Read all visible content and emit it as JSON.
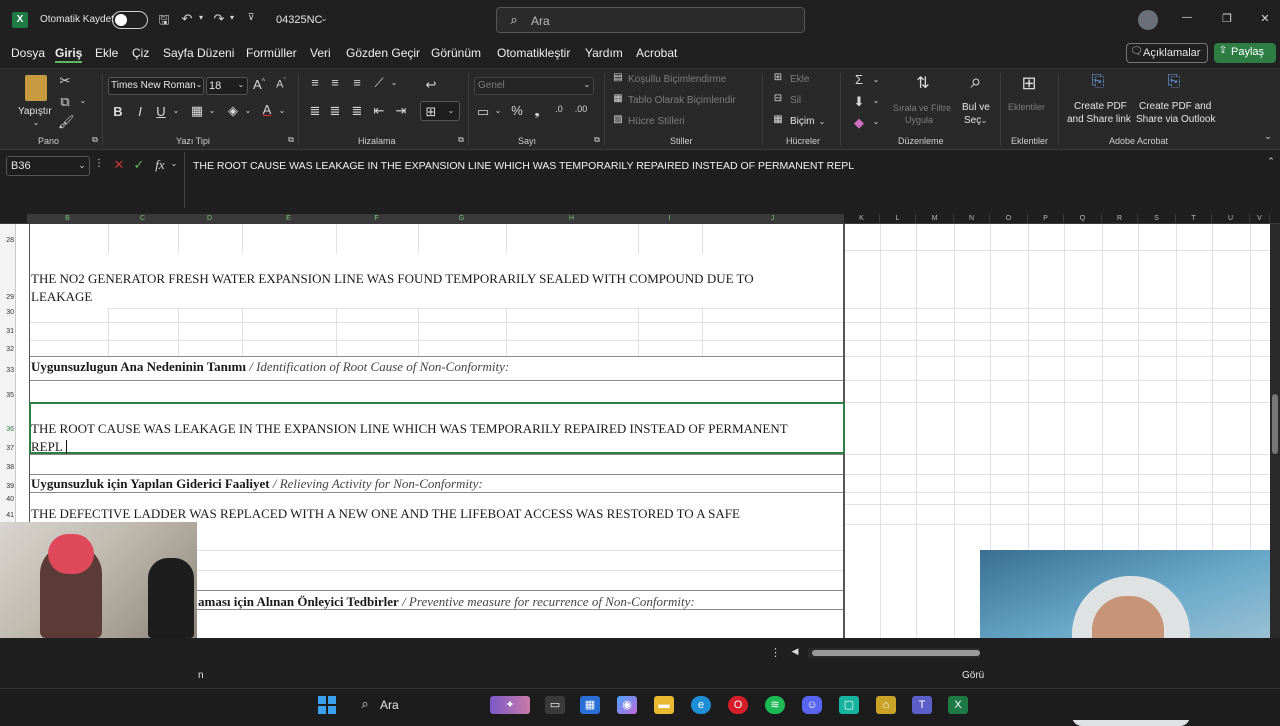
{
  "titlebar": {
    "autosave_label": "Otomatik Kaydet",
    "filename": "04325NC",
    "search_placeholder": "Ara",
    "minimize": "—",
    "maximize": "❐",
    "close": "✕"
  },
  "menu": {
    "items": [
      "Dosya",
      "Giriş",
      "Ekle",
      "Çiz",
      "Sayfa Düzeni",
      "Formüller",
      "Veri",
      "Gözden Geçir",
      "Görünüm",
      "Otomatikleştir",
      "Yardım",
      "Acrobat"
    ],
    "comments": "Açıklamalar",
    "share": "Paylaş"
  },
  "ribbon": {
    "paste": "Yapıştır",
    "clipboard_group": "Pano",
    "font_name": "Times New Roman",
    "font_size": "18",
    "font_group": "Yazı Tipi",
    "alignment_group": "Hizalama",
    "number_format": "Genel",
    "number_group": "Sayı",
    "conditional": "Koşullu Biçimlendirme",
    "format_table": "Tablo Olarak Biçimlendir",
    "cell_styles": "Hücre Stilleri",
    "styles_group": "Stiller",
    "insert": "Ekle",
    "delete": "Sil",
    "format": "Biçim",
    "cells_group": "Hücreler",
    "sort_filter_line1": "Sırala ve Filtre",
    "sort_filter_line2": "Uygula",
    "find_line1": "Bul ve",
    "find_line2": "Seç",
    "editing_group": "Düzenleme",
    "addins": "Eklentiler",
    "addins_group": "Eklentiler",
    "pdf_share_line1": "Create PDF",
    "pdf_share_line2": "and Share link",
    "pdf_outlook_line1": "Create PDF and",
    "pdf_outlook_line2": "Share via Outlook",
    "acrobat_group": "Adobe Acrobat"
  },
  "formula_bar": {
    "name_box": "B36",
    "fx": "fx",
    "content": "THE ROOT CAUSE WAS LEAKAGE IN THE EXPANSION LINE WHICH WAS TEMPORARILY REPAIRED INSTEAD OF PERMANENT REPL"
  },
  "columns": [
    "B",
    "C",
    "D",
    "E",
    "F",
    "G",
    "H",
    "I",
    "J",
    "K",
    "L",
    "M",
    "N",
    "O",
    "P",
    "Q",
    "R",
    "S",
    "T",
    "U",
    "V"
  ],
  "rows": [
    "28",
    "29",
    "30",
    "31",
    "32",
    "33",
    "35",
    "36",
    "37",
    "38",
    "39",
    "40",
    "41"
  ],
  "sheet": {
    "finding_line1": "THE NO2 GENERATOR FRESH WATER EXPANSION LINE WAS FOUND TEMPORARILY SEALED WITH COMPOUND DUE TO",
    "finding_line2": "LEAKAGE",
    "root_cause_label_tr": "Uygunsuzlugun Ana Nedeninin Tanımı",
    "root_cause_label_en": "/ Identification of Root Cause of Non-Conformity:",
    "root_cause_line1": "THE ROOT CAUSE WAS LEAKAGE IN THE EXPANSION LINE WHICH WAS TEMPORARILY REPAIRED INSTEAD OF PERMANENT",
    "root_cause_line2": "REPL",
    "relieving_label_tr": "Uygunsuzluk için Yapılan Giderici Faaliyet",
    "relieving_label_en": "/ Relieving Activity for Non-Conformity:",
    "relieving_text": "THE DEFECTIVE LADDER WAS REPLACED WITH A NEW ONE AND THE LIFEBOAT ACCESS WAS RESTORED TO A SAFE",
    "preventive_label_tr": "aması için Alınan Önleyici Tedbirler",
    "preventive_label_en": "/ Preventive measure for recurrence of Non-Conformity:"
  },
  "statusbar": {
    "left_text": "n",
    "view_label": "Görü"
  },
  "taskbar": {
    "search": "Ara"
  }
}
